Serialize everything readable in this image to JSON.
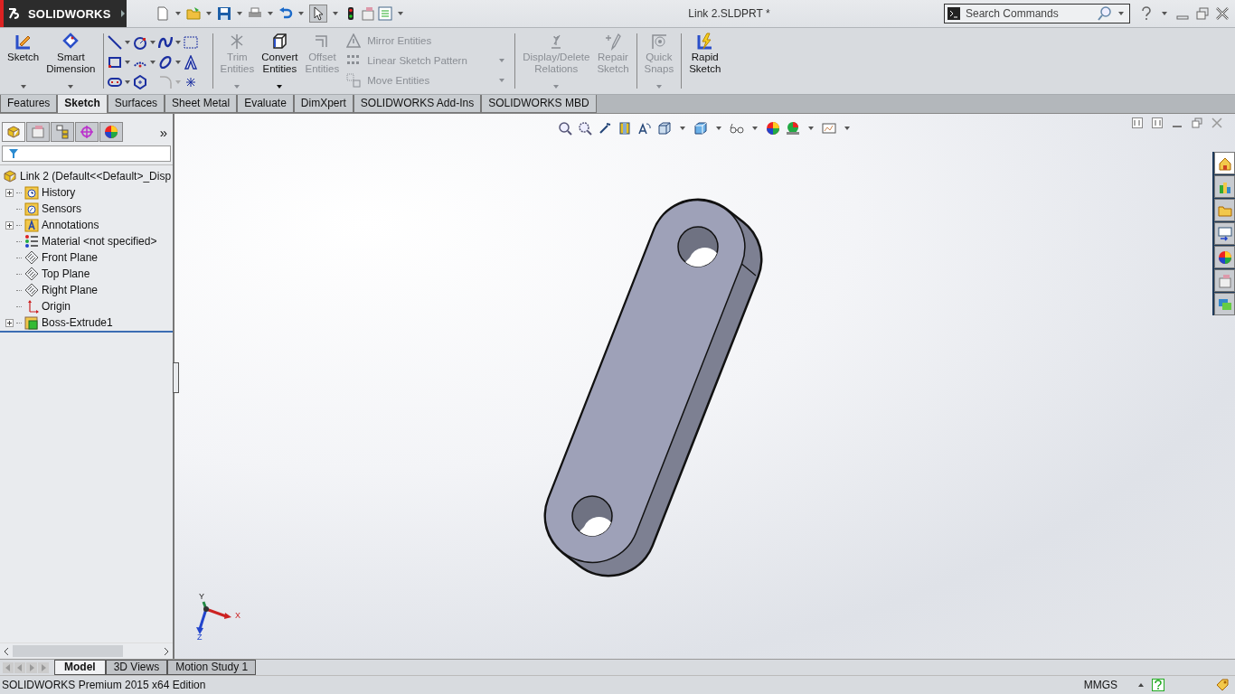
{
  "app": {
    "logo": "SOLIDWORKS"
  },
  "window": {
    "title": "Link 2.SLDPRT *"
  },
  "search": {
    "placeholder": "Search Commands"
  },
  "ribbon": {
    "sketch_group": [
      {
        "label": "Sketch",
        "kind": "sketch",
        "disabled": false,
        "dropdown": true
      },
      {
        "label": "Smart Dimension",
        "kind": "dimension",
        "disabled": false,
        "dropdown": true
      }
    ],
    "edit_group": [
      {
        "label": "Trim Entities",
        "kind": "trim",
        "disabled": true,
        "dropdown": true
      },
      {
        "label": "Convert Entities",
        "kind": "convert",
        "disabled": false,
        "dropdown": true
      },
      {
        "label": "Offset Entities",
        "kind": "offset",
        "disabled": true,
        "dropdown": false
      }
    ],
    "list_group": [
      {
        "label": "Mirror Entities",
        "kind": "mirror",
        "disabled": true,
        "dropdown": false
      },
      {
        "label": "Linear Sketch Pattern",
        "kind": "pattern",
        "disabled": true,
        "dropdown": true
      },
      {
        "label": "Move Entities",
        "kind": "move",
        "disabled": true,
        "dropdown": true
      }
    ],
    "relations_group": [
      {
        "label": "Display/Delete Relations",
        "kind": "relations",
        "disabled": true,
        "dropdown": true
      },
      {
        "label": "Repair Sketch",
        "kind": "repair",
        "disabled": true,
        "dropdown": false
      }
    ],
    "snaps_group": [
      {
        "label": "Quick Snaps",
        "kind": "snaps",
        "disabled": true,
        "dropdown": true
      }
    ],
    "rapid_group": [
      {
        "label": "Rapid Sketch",
        "kind": "rapid",
        "disabled": false,
        "dropdown": false
      }
    ]
  },
  "tabs": [
    {
      "label": "Features",
      "selected": false
    },
    {
      "label": "Sketch",
      "selected": true
    },
    {
      "label": "Surfaces",
      "selected": false
    },
    {
      "label": "Sheet Metal",
      "selected": false
    },
    {
      "label": "Evaluate",
      "selected": false
    },
    {
      "label": "DimXpert",
      "selected": false
    },
    {
      "label": "SOLIDWORKS Add-Ins",
      "selected": false
    },
    {
      "label": "SOLIDWORKS MBD",
      "selected": false
    }
  ],
  "feature_tree": {
    "more": "»",
    "root": {
      "label": "Link 2  (Default<<Default>_Disp",
      "children": [
        {
          "label": "History",
          "kind": "history",
          "has_children": true
        },
        {
          "label": "Sensors",
          "kind": "sensors",
          "has_children": false
        },
        {
          "label": "Annotations",
          "kind": "annotations",
          "has_children": true
        },
        {
          "label": "Material <not specified>",
          "kind": "material",
          "has_children": false
        },
        {
          "label": "Front Plane",
          "kind": "plane",
          "has_children": false
        },
        {
          "label": "Top Plane",
          "kind": "plane",
          "has_children": false
        },
        {
          "label": "Right Plane",
          "kind": "plane",
          "has_children": false
        },
        {
          "label": "Origin",
          "kind": "origin",
          "has_children": false
        },
        {
          "label": "Boss-Extrude1",
          "kind": "feature",
          "has_children": true
        }
      ]
    }
  },
  "triad": {
    "x": "X",
    "y": "Y",
    "z": "Z"
  },
  "task_pane": [
    {
      "kind": "home",
      "selected": true
    },
    {
      "kind": "library",
      "selected": false
    },
    {
      "kind": "folder",
      "selected": false
    },
    {
      "kind": "palette",
      "selected": false
    },
    {
      "kind": "appearance",
      "selected": false
    },
    {
      "kind": "properties",
      "selected": false
    },
    {
      "kind": "forum",
      "selected": false
    }
  ],
  "bottom_tabs": [
    {
      "label": "Model",
      "selected": true
    },
    {
      "label": "3D Views",
      "selected": false
    },
    {
      "label": "Motion Study 1",
      "selected": false
    }
  ],
  "status_bar": {
    "edition": "SOLIDWORKS Premium 2015 x64 Edition",
    "units": "MMGS"
  }
}
